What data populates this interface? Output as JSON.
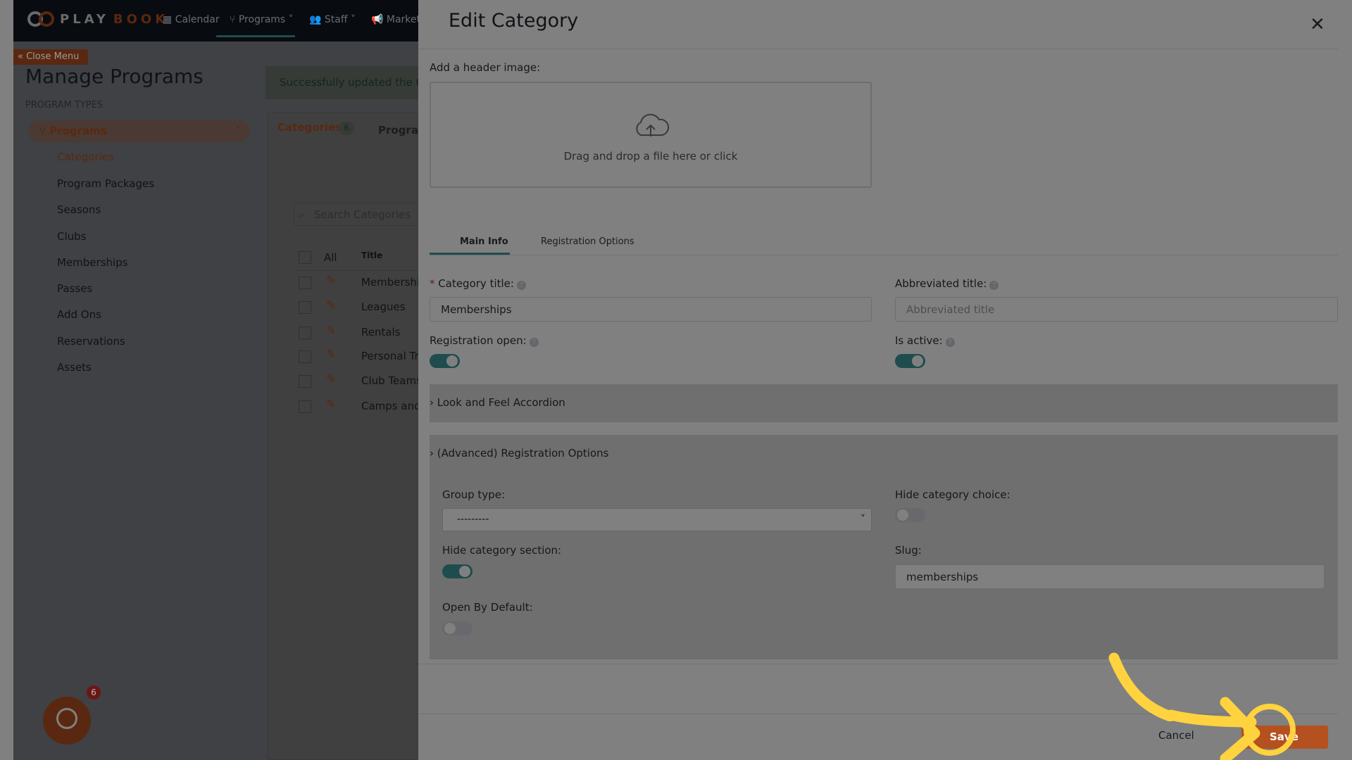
{
  "nav": {
    "logo_left": "PLAY",
    "logo_right": "BOOK",
    "items": [
      "Calendar",
      "Programs",
      "Staff",
      "Market"
    ]
  },
  "sidebar": {
    "close_menu": "Close Menu",
    "title": "Manage Programs",
    "section": "PROGRAM TYPES",
    "group": "Programs",
    "items": [
      "Categories",
      "Program Packages",
      "Seasons",
      "Clubs",
      "Memberships",
      "Passes",
      "Add Ons",
      "Reservations",
      "Assets"
    ]
  },
  "main": {
    "alert": "Successfully updated the Category",
    "tabs": {
      "categories": "Categories",
      "count": "6",
      "programs": "Programs"
    },
    "search_placeholder": "Search Categories",
    "table": {
      "all": "All",
      "title_col": "Title",
      "rows": [
        "Memberships",
        "Leagues",
        "Rentals",
        "Personal Training",
        "Club Teams",
        "Camps and Clinics"
      ]
    }
  },
  "chat": {
    "badge": "6"
  },
  "panel": {
    "title": "Edit Category",
    "header_image_label": "Add a header image:",
    "dropzone_text": "Drag and drop a file here or click",
    "tabs": [
      "Main Info",
      "Registration Options"
    ],
    "category_title_label": "Category title:",
    "category_title_value": "Memberships",
    "abbrev_label": "Abbreviated title:",
    "abbrev_placeholder": "Abbreviated title",
    "registration_open_label": "Registration open:",
    "registration_open": true,
    "is_active_label": "Is active:",
    "is_active": true,
    "accordion_look": "Look and Feel Accordion",
    "accordion_advanced": "(Advanced) Registration Options",
    "group_type_label": "Group type:",
    "group_type_value": "---------",
    "hide_choice_label": "Hide category choice:",
    "hide_choice": false,
    "hide_section_label": "Hide category section:",
    "hide_section": true,
    "slug_label": "Slug:",
    "slug_value": "memberships",
    "open_default_label": "Open By Default:",
    "open_default": false,
    "cancel": "Cancel",
    "save": "Save"
  },
  "colors": {
    "brand": "#b5501f",
    "teal": "#3d9a9a",
    "highlight": "#ffd23f"
  }
}
